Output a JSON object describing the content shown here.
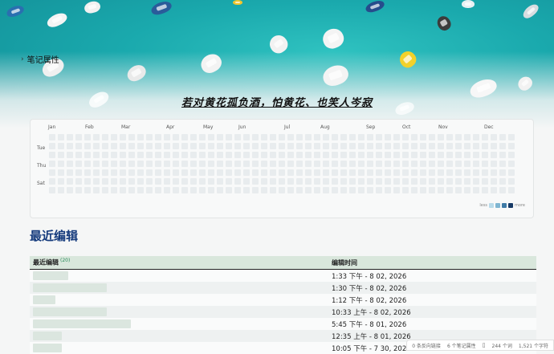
{
  "properties_toggle": {
    "label": "笔记属性"
  },
  "banner": {
    "quote": "若对黄花孤负酒，怕黄花、也笑人岑寂"
  },
  "heatmap": {
    "months": [
      "Jan",
      "Feb",
      "Mar",
      "Apr",
      "May",
      "Jun",
      "Jul",
      "Aug",
      "Sep",
      "Oct",
      "Nov",
      "Dec"
    ],
    "weekdays": [
      "Tue",
      "Thu",
      "Sat"
    ],
    "legend_less": "less",
    "legend_more": "more",
    "legend_colors": [
      "#b9dbea",
      "#7fb6d1",
      "#3d7aa6",
      "#173a66"
    ],
    "empty_color": "#e8ecee"
  },
  "section": {
    "title": "最近编辑"
  },
  "table": {
    "col1_header": "最近编辑",
    "col1_count": "(20)",
    "col2_header": "编辑时间",
    "rows": [
      {
        "time": "1:33 下午 - 8 02, 2026"
      },
      {
        "time": "1:30 下午 - 8 02, 2026"
      },
      {
        "time": "1:12 下午 - 8 02, 2026"
      },
      {
        "time": "10:33 上午 - 8 02, 2026"
      },
      {
        "time": "5:45 下午 - 8 01, 2026"
      },
      {
        "time": "12:35 上午 - 8 01, 2026"
      },
      {
        "time": "10:05 下午 - 7 30, 2026"
      }
    ]
  },
  "statusbar": {
    "backlinks": "0 条反向链接",
    "properties": "6 个笔记属性",
    "words": "244 个词",
    "chars": "1,521 个字符"
  }
}
